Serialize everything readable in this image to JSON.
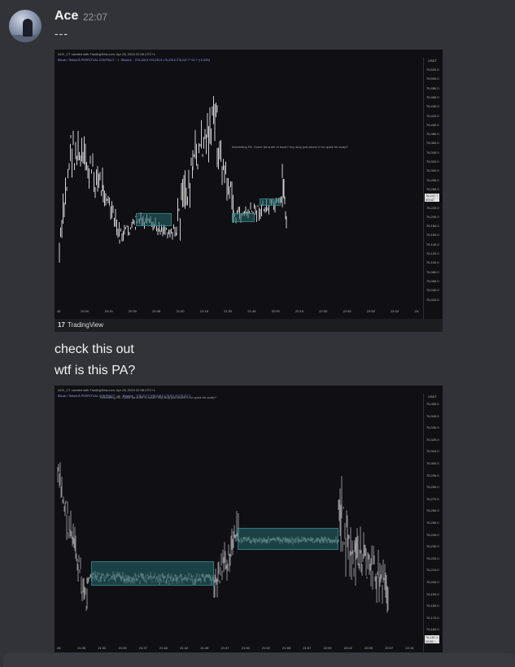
{
  "message": {
    "author": "Ace",
    "time": "22:07",
    "first_line": "---",
    "lines": [
      "check this out",
      "wtf is this PA?"
    ]
  },
  "chart1": {
    "created_by": "ACE_CT created with TradingView.com, Apr 28, 2024 22:06 UTC+1",
    "symbol_line": "Bitcoin / TetherUS PERPETUAL CONTRACT · 1 · Binance",
    "ohlc": "O76,226.9 H76,230.0 L76,226.6 C76,247.7 +21.7 (+0.03%)",
    "currency": "USDT",
    "annotation": "Interesting PA. Some fat order in book? buy stop just above it for quick tm scalp?",
    "price_ticks": [
      "76,520.0",
      "76,500.0",
      "76,480.0",
      "76,460.0",
      "76,440.0",
      "76,420.0",
      "76,400.0",
      "76,380.0",
      "76,360.0",
      "76,340.0",
      "76,320.0",
      "76,300.0",
      "76,280.0",
      "76,260.0",
      "76,240.0",
      "76,220.0",
      "76,200.0",
      "76,180.0",
      "76,160.0",
      "76,140.0",
      "76,120.0",
      "76,100.0",
      "76,080.0",
      "76,060.0",
      "76,040.0",
      "76,020.0"
    ],
    "current_price": "76,247.7",
    "current_sub": "00:53",
    "time_ticks": [
      "45",
      "20:00",
      "20:15",
      "20:30",
      "20:45",
      "21:00",
      "21:15",
      "21:30",
      "21:45",
      "22:00",
      "22:15",
      "22:30",
      "22:45",
      "23:00",
      "23:15",
      "23:"
    ],
    "footer": "TradingView"
  },
  "chart2": {
    "created_by": "ACE_CT created with TradingView.com, Apr 28, 2024 22:08 UTC+1",
    "symbol_line": "Bitcoin / TetherUS PERPETUAL CONTRACT · 1s · Binance",
    "ohlc": "O76,217.7 H76,218.0 L76,217.6 C76,217.7",
    "annotation": "Interesting PA. Some fat order in book? buy stop just above it for quick tm scalp?",
    "currency": "USDT",
    "price_ticks": [
      "76,350.0",
      "76,340.0",
      "76,330.0",
      "76,320.0",
      "76,310.0",
      "76,300.0",
      "76,290.0",
      "76,280.0",
      "76,270.0",
      "76,260.0",
      "76,250.0",
      "76,240.0",
      "76,230.0",
      "76,220.0",
      "76,210.0",
      "76,200.0",
      "76,190.0",
      "76,180.0",
      "76,170.0",
      "76,160.0",
      "76,150.0"
    ],
    "current_price": "76,157.4",
    "current_sub": "00:51",
    "time_ticks": [
      "28",
      "21:30",
      "21:32",
      "21:35",
      "21:37",
      "21:40",
      "21:42",
      "21:45",
      "21:47",
      "21:50",
      "21:52",
      "21:55",
      "21:57",
      "22:00",
      "22:02",
      "22:05",
      "22:07",
      "22:10"
    ]
  },
  "colors": {
    "background": "#313338",
    "chart_bg": "#101014",
    "zone": "#26696e",
    "candle": "#d7d7d7"
  }
}
